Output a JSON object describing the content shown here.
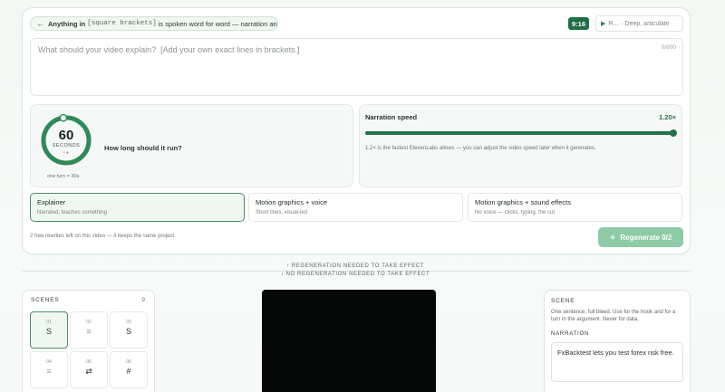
{
  "header": {
    "hint_bold": "Anything in",
    "hint_code": "[square brackets]",
    "hint_rest": "is spoken word for word — narration and subtitles",
    "ratio": "9:16",
    "voice_short": "R...",
    "voice_desc": "· Deep, articulate ·"
  },
  "prompt": {
    "placeholder": "What should your video explain?  [Add your own exact lines in brackets.]",
    "value": "",
    "char_count": "0/800"
  },
  "duration": {
    "value": "60",
    "unit": "SECONDS",
    "dots": "• ●",
    "sub": "one turn = 30s",
    "question": "How long should it run?",
    "fraction": 0.98
  },
  "speed": {
    "label": "Narration speed",
    "value": "1.20×",
    "fraction": 1.0,
    "note": "1.2× is the fastest ElevenLabs allows — you can adjust the video speed later when it generates."
  },
  "styles": [
    {
      "title": "Explainer",
      "desc": "Narrated, teaches something",
      "active": true
    },
    {
      "title": "Motion graphics + voice",
      "desc": "Short lines, visual-led",
      "active": false
    },
    {
      "title": "Motion graphics + sound effects",
      "desc": "No voice — clicks, typing, the cut",
      "active": false
    }
  ],
  "rewrites_note": "2 free rewrites left on this video — it keeps the same project.",
  "regen_button": "Regenerate 0/2",
  "regen_needed": "↑  REGENERATION NEEDED TO TAKE EFFECT",
  "regen_not_needed": "↓  NO REGENERATION NEEDED TO TAKE EFFECT",
  "scenes": {
    "heading": "SCENES",
    "count": "9",
    "tiles": [
      {
        "num": "01",
        "glyph": "S",
        "active": true
      },
      {
        "num": "02",
        "glyph": "≡",
        "active": false
      },
      {
        "num": "03",
        "glyph": "S",
        "active": false
      },
      {
        "num": "04",
        "glyph": "≡",
        "active": false
      },
      {
        "num": "05",
        "glyph": "⇄",
        "active": false
      },
      {
        "num": "06",
        "glyph": "#",
        "active": false
      }
    ]
  },
  "scene_detail": {
    "heading": "SCENE",
    "desc": "One sentence, full bleed. Use for the hook and for a turn in the argument. Never for data.",
    "narration_heading": "NARRATION",
    "narration": "FxBacktest lets you test forex risk free."
  },
  "colors": {
    "accent": "#237249",
    "accent_light": "#8fcba6",
    "active_bg": "#eef7f0"
  },
  "icons": {
    "back": "arrow-left-icon",
    "play": "play-icon",
    "sparkle": "sparkle-icon"
  }
}
